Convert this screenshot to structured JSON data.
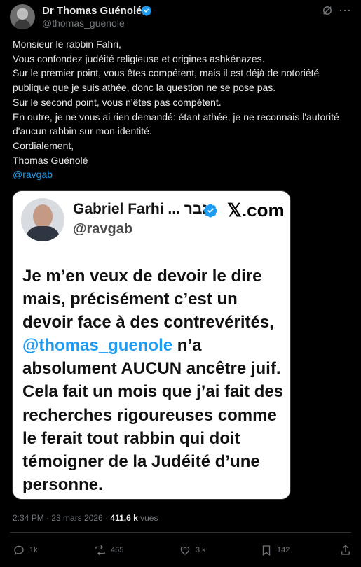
{
  "author": {
    "name": "Dr Thomas Guénolé",
    "handle": "@thomas_guenole"
  },
  "tweet": {
    "text": "Monsieur le rabbin Fahri,\nVous confondez judéité religieuse et origines ashkénazes.\nSur le premier point, vous êtes compétent, mais il est déjà de notoriété publique que je suis athée, donc la question ne se pose pas.\nSur le second point, vous n'êtes pas compétent.\nEn outre, je ne vous ai rien demandé: étant athée, je ne reconnais l'autorité d'aucun rabbin sur mon identité.\nCordialement,\nThomas Guénolé",
    "mention": "@ravgab"
  },
  "card": {
    "name": "Gabriel Farhi ... גבר",
    "handle": "@ravgab",
    "site": "𝕏.com",
    "body_before": "Je m’en veux de devoir le dire mais, précisément c’est un devoir face à des contrevérités, ",
    "body_mention": "@thomas_guenole",
    "body_after": " n’a absolument AUCUN ancêtre juif. Cela fait un mois que j’ai fait des recherches rigoureuses comme le ferait tout rabbin qui doit témoigner de la Judéité d’une personne."
  },
  "meta": {
    "time": "2:34 PM · 23 mars 2026 · ",
    "views_count": "411,6 k",
    "views_label": " vues"
  },
  "actions": {
    "replies": "1k",
    "reposts": "465",
    "likes": "3 k",
    "bookmarks": "142"
  },
  "colors": {
    "accent": "#1d9bf0",
    "background": "#000000",
    "muted": "#71767b"
  },
  "icons": [
    "verified-badge-icon",
    "grok-icon",
    "more-icon",
    "reply-icon",
    "repost-icon",
    "like-icon",
    "bookmark-icon",
    "share-icon"
  ]
}
